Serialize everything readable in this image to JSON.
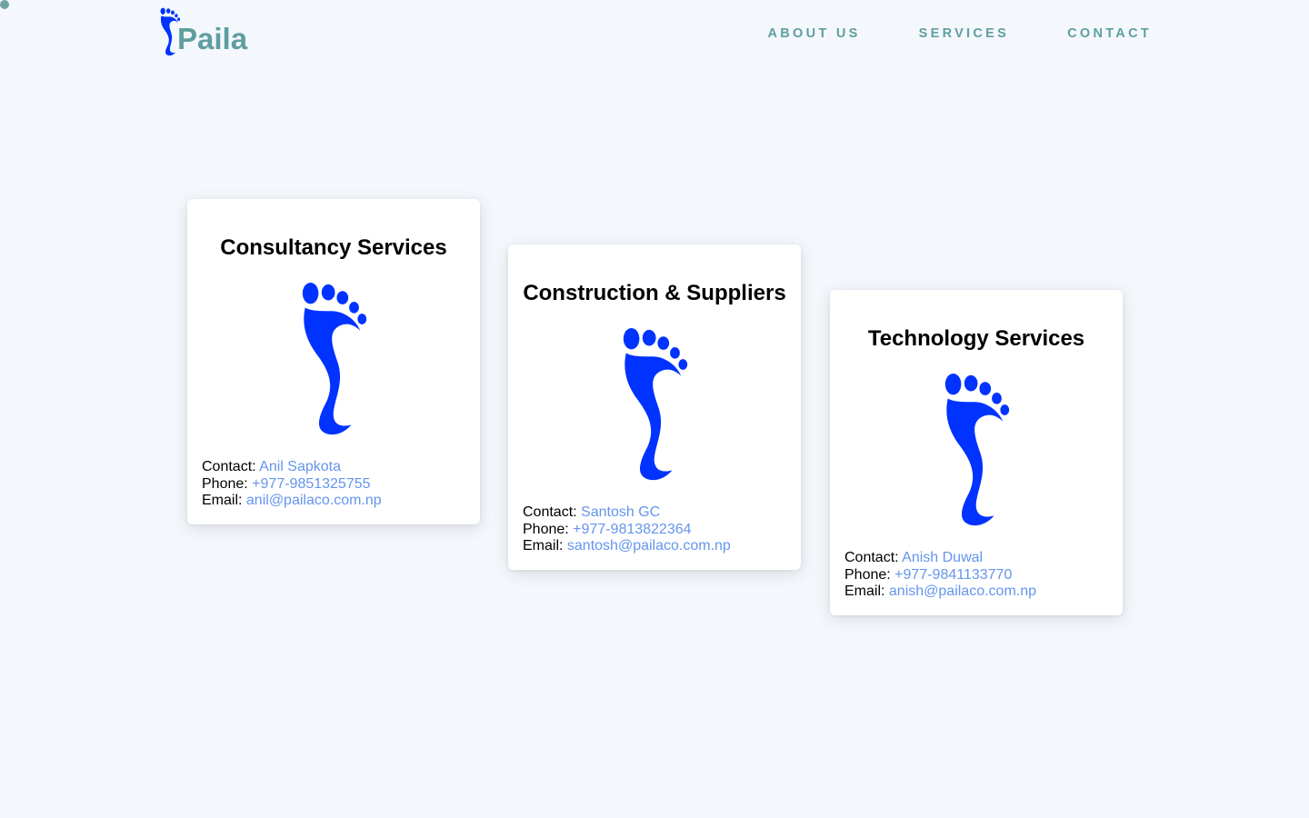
{
  "brand": {
    "name": "Paila",
    "color": "#5f9ea0",
    "icon": "footprint-icon"
  },
  "nav": [
    {
      "label": "ABOUT US"
    },
    {
      "label": "SERVICES"
    },
    {
      "label": "CONTACT"
    }
  ],
  "accent_color": "#6495ed",
  "footprint_color": "#0033ff",
  "cards": [
    {
      "title": "Consultancy Services",
      "contact_label": "Contact:",
      "contact": "Anil Sapkota",
      "phone_label": "Phone:",
      "phone": "+977-9851325755",
      "email_label": "Email:",
      "email": "anil@pailaco.com.np"
    },
    {
      "title": "Construction & Suppliers",
      "contact_label": "Contact:",
      "contact": "Santosh GC",
      "phone_label": "Phone:",
      "phone": "+977-9813822364",
      "email_label": "Email:",
      "email": "santosh@pailaco.com.np"
    },
    {
      "title": "Technology Services",
      "contact_label": "Contact:",
      "contact": "Anish Duwal",
      "phone_label": "Phone:",
      "phone": "+977-9841133770",
      "email_label": "Email:",
      "email": "anish@pailaco.com.np"
    }
  ]
}
